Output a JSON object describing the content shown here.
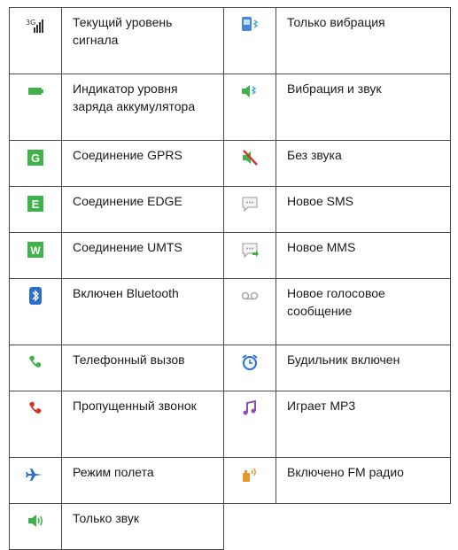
{
  "table": {
    "rows": [
      {
        "left": {
          "icon": "signal-strength-icon",
          "label": "Текущий уровень сигнала"
        },
        "right": {
          "icon": "vibrate-only-icon",
          "label": "Только вибрация"
        }
      },
      {
        "left": {
          "icon": "battery-icon",
          "label": "Индикатор уровня заряда аккумулятора"
        },
        "right": {
          "icon": "vibrate-and-sound-icon",
          "label": "Вибрация и звук"
        }
      },
      {
        "left": {
          "icon": "gprs-icon",
          "letter": "G",
          "label": "Соединение GPRS"
        },
        "right": {
          "icon": "silent-icon",
          "label": "Без звука"
        }
      },
      {
        "left": {
          "icon": "edge-icon",
          "letter": "E",
          "label": "Соединение EDGE"
        },
        "right": {
          "icon": "new-sms-icon",
          "label": "Новое SMS"
        }
      },
      {
        "left": {
          "icon": "umts-icon",
          "letter": "W",
          "label": "Соединение UMTS"
        },
        "right": {
          "icon": "new-mms-icon",
          "label": "Новое MMS"
        }
      },
      {
        "left": {
          "icon": "bluetooth-icon",
          "label": "Включен Bluetooth"
        },
        "right": {
          "icon": "voicemail-icon",
          "label": "Новое голосовое сообщение"
        }
      },
      {
        "left": {
          "icon": "phone-call-icon",
          "label": "Телефонный вызов"
        },
        "right": {
          "icon": "alarm-clock-icon",
          "label": "Будильник включен"
        }
      },
      {
        "left": {
          "icon": "missed-call-icon",
          "label": "Пропущенный звонок"
        },
        "right": {
          "icon": "music-note-icon",
          "label": "Играет MP3"
        }
      },
      {
        "left": {
          "icon": "airplane-icon",
          "label": "Режим полета"
        },
        "right": {
          "icon": "fm-radio-icon",
          "label": "Включено FM радио"
        }
      },
      {
        "left": {
          "icon": "sound-only-icon",
          "label": "Только звук"
        }
      }
    ]
  },
  "colors": {
    "green": "#3fb24a",
    "red": "#d9302a",
    "blue": "#2b6fc9",
    "purple": "#8a4fb8",
    "orange": "#e8962a",
    "border": "#4a4a4a"
  }
}
